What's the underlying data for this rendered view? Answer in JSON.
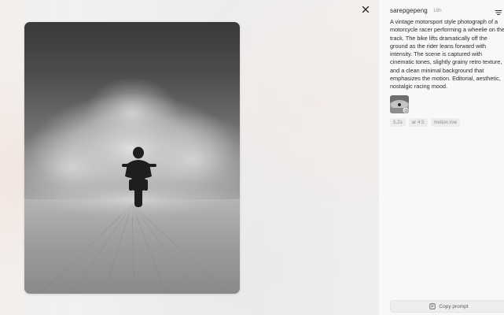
{
  "author": {
    "username": "sarepgepeng",
    "time_ago": "18h"
  },
  "prompt": {
    "lines": [
      "A vintage motorsport style photograph of a",
      "motorcycle racer performing a wheelie on the",
      "track. The bike lifts dramatically off the",
      "ground as the rider leans forward with",
      "intensity. The scene is captured with",
      "cinematic tones, slightly grainy retro texture,",
      "and a clean minimal background that",
      "emphasizes the motion. Editorial, aesthetic,",
      "nostalgic racing mood."
    ]
  },
  "parameters": [
    "5.2s",
    "ar 4:5",
    "motion low"
  ],
  "actions": {
    "copy_label": "Copy prompt"
  },
  "icons": {
    "close": "close-icon",
    "filter": "filter-lines-icon",
    "like": "heart-icon",
    "copy": "copy-icon",
    "thumb_badge": "video-badge-icon"
  },
  "colors": {
    "panel_bg": "#f8f8f8",
    "chip_bg": "#ececec",
    "chip_text": "#8b8d99",
    "muted_text": "#9a9aa3"
  }
}
